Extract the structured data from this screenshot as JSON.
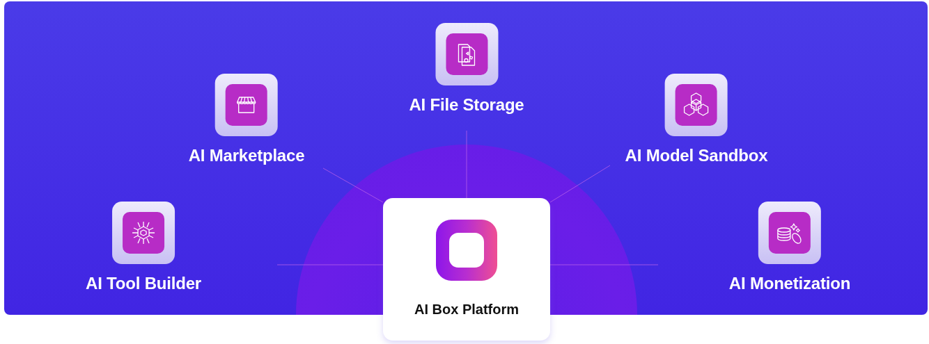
{
  "modules": [
    {
      "label": "AI File Storage"
    },
    {
      "label": "AI Marketplace"
    },
    {
      "label": "AI Model Sandbox"
    },
    {
      "label": "AI Tool Builder"
    },
    {
      "label": "AI Monetization"
    }
  ],
  "platform": {
    "label": "AI Box Platform"
  }
}
